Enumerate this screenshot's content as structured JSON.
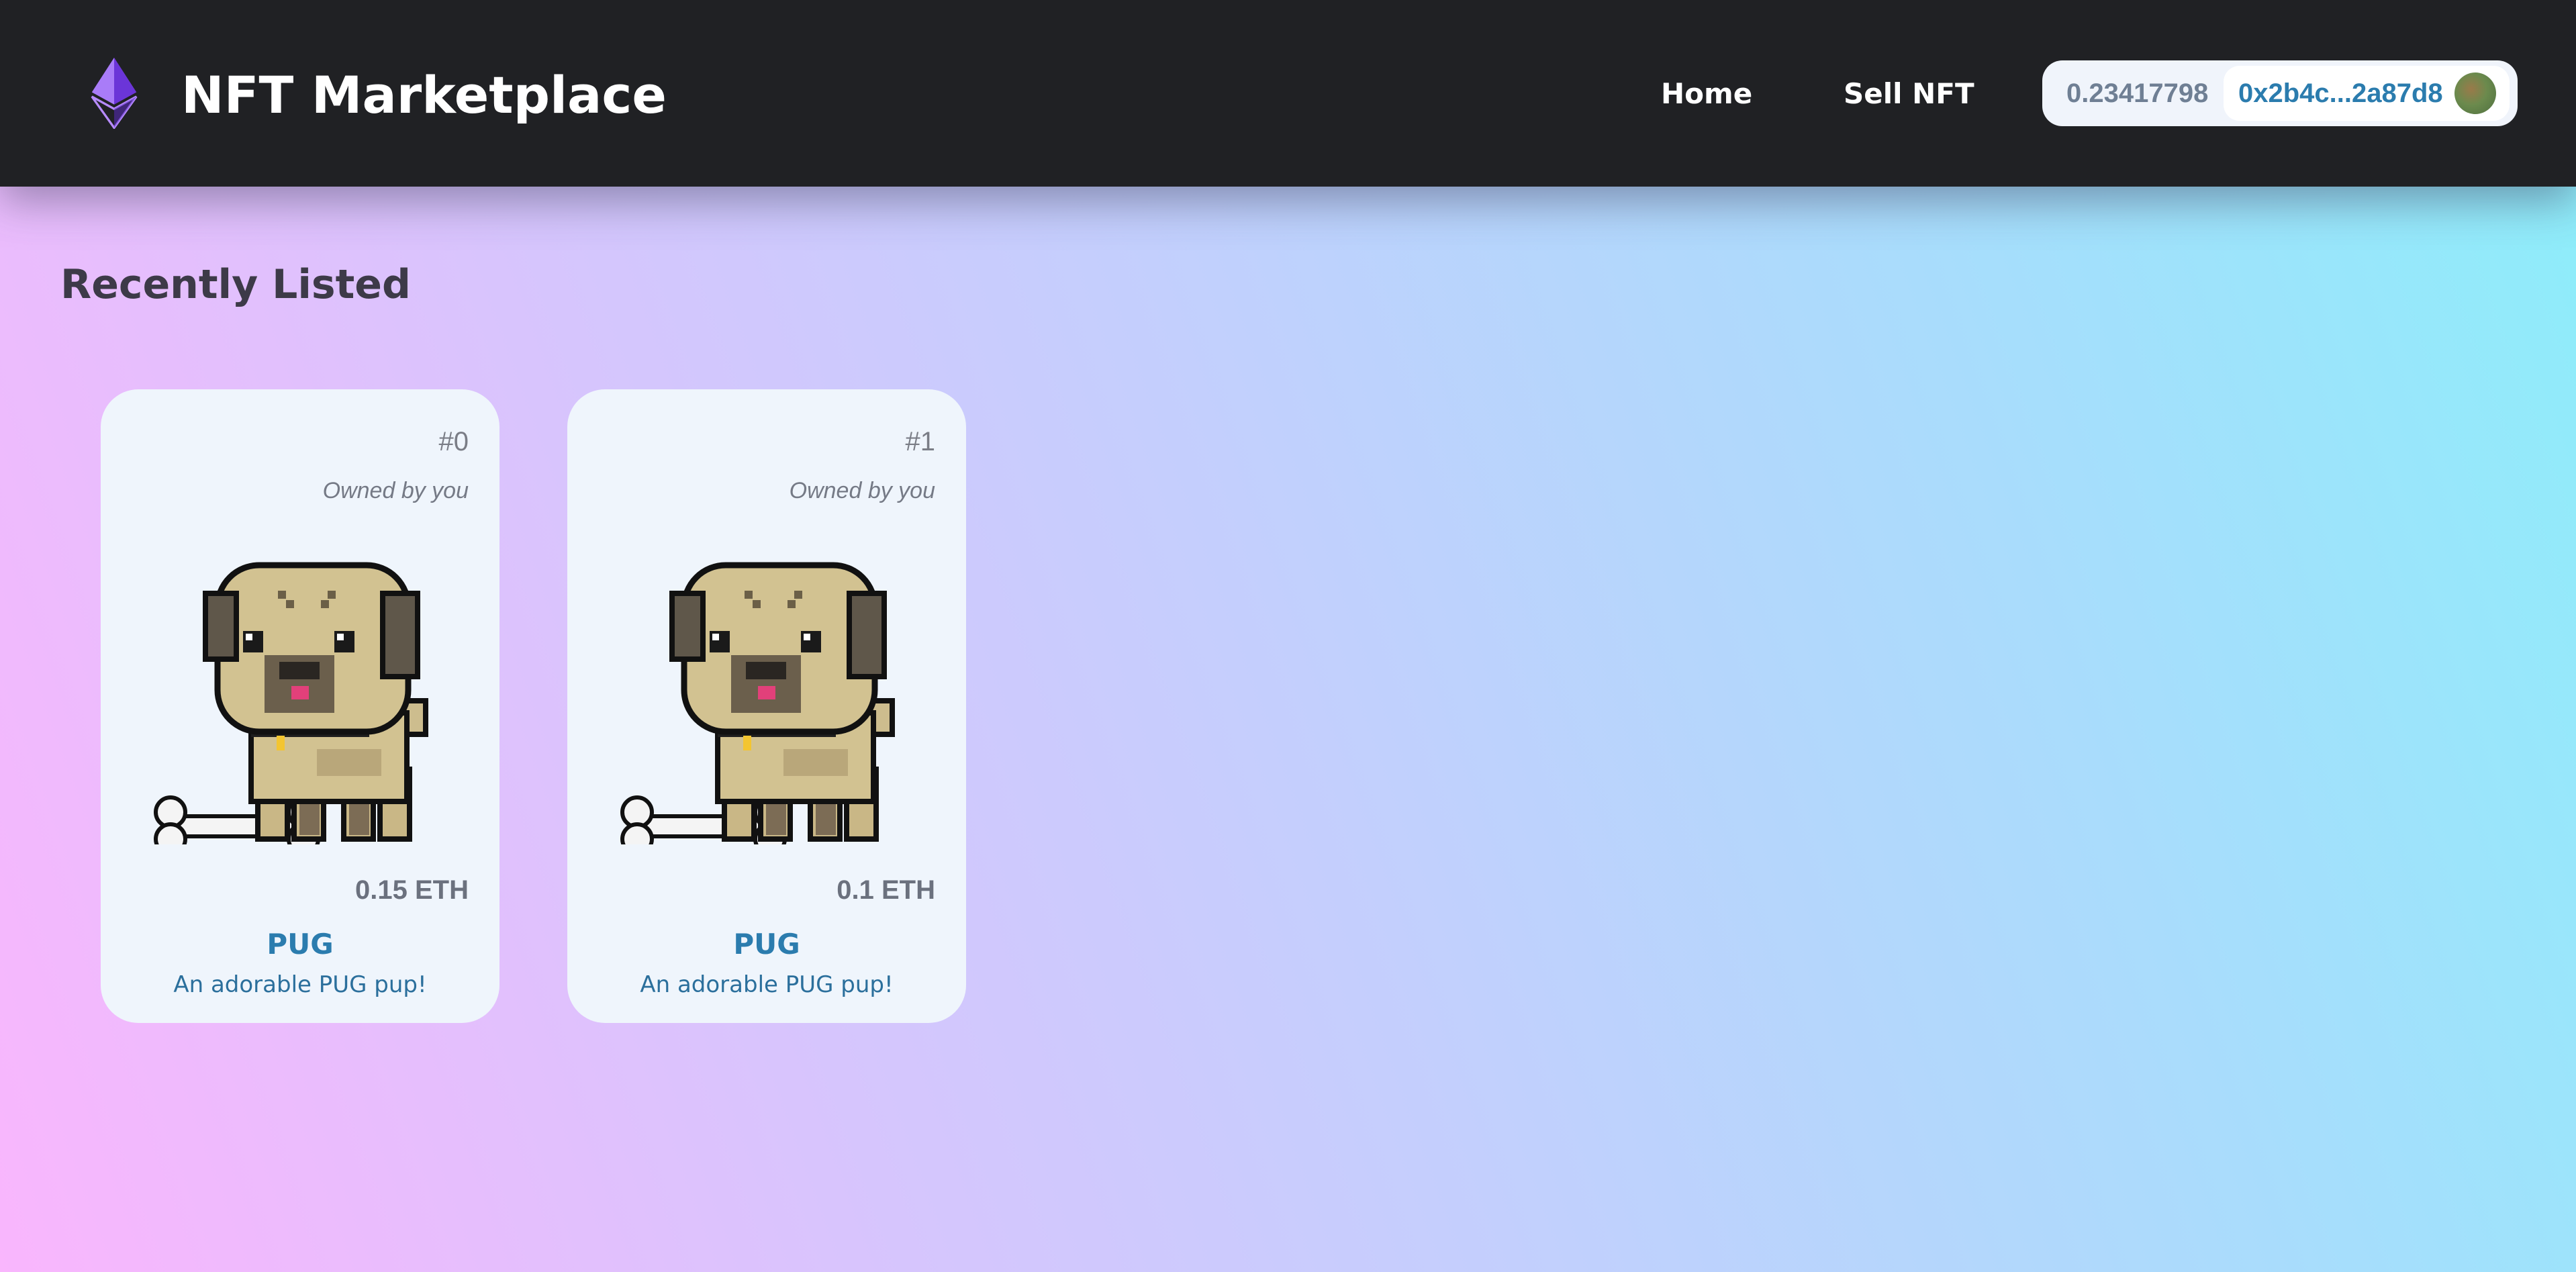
{
  "navbar": {
    "brand": "NFT Marketplace",
    "logo_icon": "ethereum-icon",
    "links": [
      {
        "label": "Home"
      },
      {
        "label": "Sell NFT"
      }
    ],
    "wallet": {
      "balance": "0.23417798",
      "address": "0x2b4c...2a87d8",
      "avatar_icon": "account-avatar"
    }
  },
  "section": {
    "title": "Recently Listed"
  },
  "listings": [
    {
      "id": "#0",
      "owner": "Owned by you",
      "price": "0.15 ETH",
      "name": "PUG",
      "description": "An adorable PUG pup!"
    },
    {
      "id": "#1",
      "owner": "Owned by you",
      "price": "0.1 ETH",
      "name": "PUG",
      "description": "An adorable PUG pup!"
    }
  ],
  "colors": {
    "navbar": "#202124",
    "accent": "#2b7cae",
    "card": "#eff5fc",
    "ethereum_purple": "#7b3fe4"
  }
}
